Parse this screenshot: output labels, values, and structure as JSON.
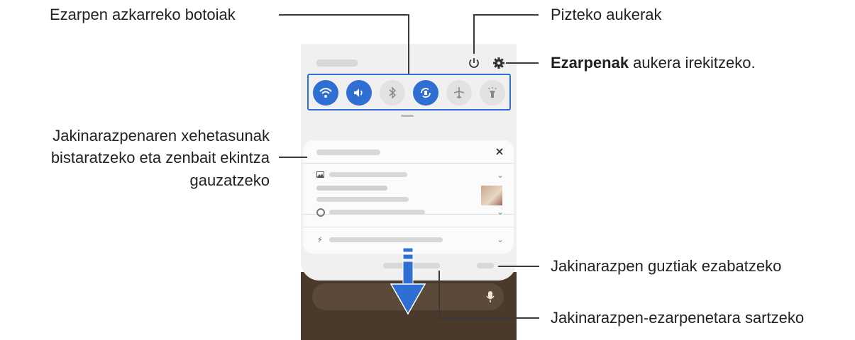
{
  "labels": {
    "quick_buttons": "Ezarpen azkarreko botoiak",
    "power": "Pizteko aukerak",
    "settings_bold": "Ezarpenak",
    "settings_rest": " aukera irekitzeko.",
    "notif_details_1": "Jakinarazpenaren xehetasunak",
    "notif_details_2": "bistaratzeko eta zenbait ekintza",
    "notif_details_3": "gauzatzeko",
    "clear_all": "Jakinarazpen guztiak ezabatzeko",
    "notif_settings": "Jakinarazpen-ezarpenetara sartzeko"
  },
  "icons": {
    "quick": [
      "wifi-icon",
      "sound-icon",
      "bluetooth-icon",
      "auto-rotate-icon",
      "airplane-icon",
      "flashlight-icon"
    ],
    "other": [
      "power-icon",
      "gear-icon",
      "close-icon",
      "image-icon",
      "mic-icon",
      "down-arrow-icon"
    ]
  },
  "colors": {
    "accent": "#2f6fd3",
    "phone_bg": "#f0f0f0",
    "wallpaper": "#4a3a2c"
  }
}
